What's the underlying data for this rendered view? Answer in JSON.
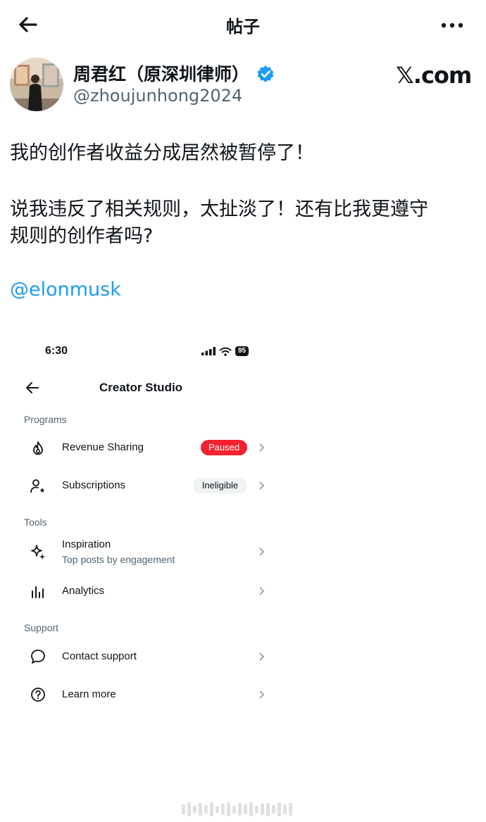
{
  "header": {
    "title": "帖子"
  },
  "author": {
    "name": "周君红（原深圳律师）",
    "handle": "@zhoujunhong2024",
    "site": "𝕏.com"
  },
  "tweet": {
    "line1": "我的创作者收益分成居然被暂停了！",
    "line2": "说我违反了相关规则，太扯淡了！还有比我更遵守",
    "line3": "规则的创作者吗?",
    "mention": "@elonmusk"
  },
  "screenshot": {
    "time": "6:30",
    "battery": "95",
    "title": "Creator Studio",
    "sections": {
      "programs": "Programs",
      "tools": "Tools",
      "support": "Support"
    },
    "rows": {
      "revenue": "Revenue Sharing",
      "revenue_status": "Paused",
      "subscriptions": "Subscriptions",
      "subscriptions_status": "Ineligible",
      "inspiration": "Inspiration",
      "inspiration_sub": "Top posts by engagement",
      "analytics": "Analytics",
      "contact": "Contact support",
      "learn": "Learn more"
    }
  },
  "colors": {
    "accent": "#1d9bf0",
    "paused": "#f4212e",
    "muted": "#536471"
  },
  "icons": [
    "back-arrow-icon",
    "more-icon",
    "verified-badge-icon",
    "flame-icon",
    "person-star-icon",
    "sparkle-icon",
    "bar-chart-icon",
    "chat-bubble-icon",
    "help-circle-icon",
    "chevron-right-icon"
  ]
}
